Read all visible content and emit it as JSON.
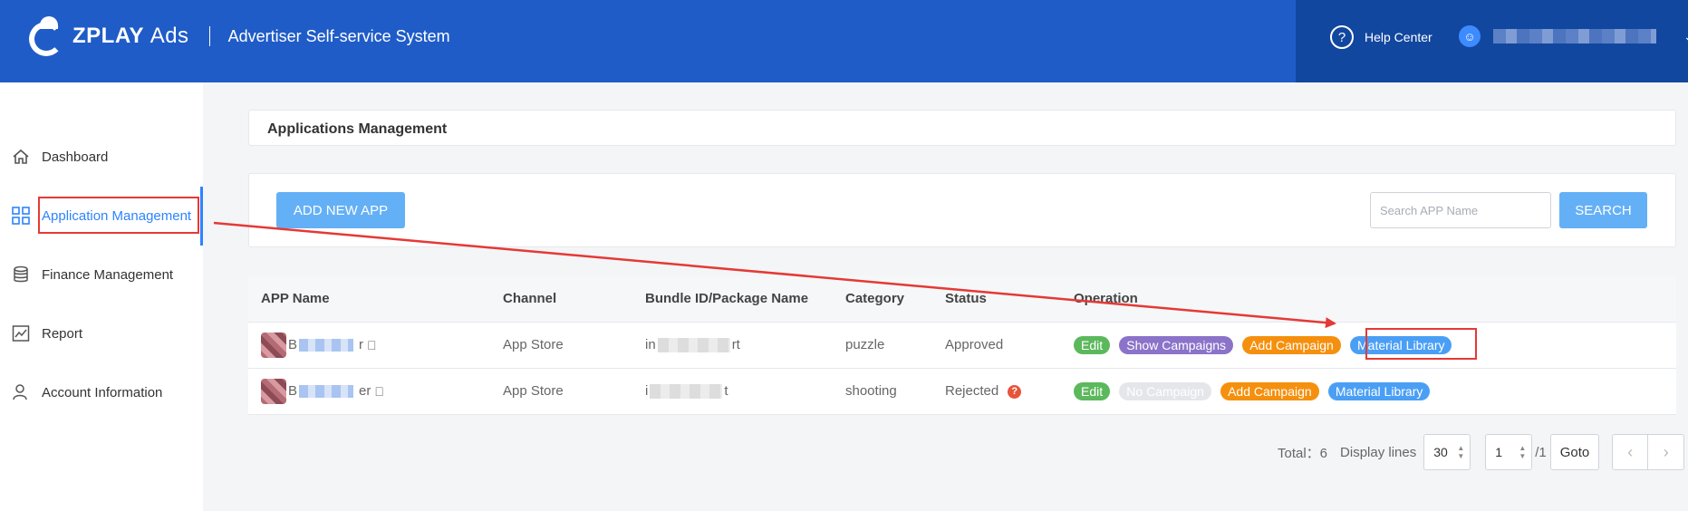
{
  "header": {
    "logo_text": "ZPLAY",
    "logo_suffix": "Ads",
    "system_title": "Advertiser Self-service System",
    "help_label": "Help Center"
  },
  "sidebar": {
    "items": [
      {
        "label": "Dashboard",
        "icon": "home-icon"
      },
      {
        "label": "Application Management",
        "icon": "grid-icon",
        "active": true
      },
      {
        "label": "Finance Management",
        "icon": "coins-icon"
      },
      {
        "label": "Report",
        "icon": "chart-icon"
      },
      {
        "label": "Account Information",
        "icon": "user-icon"
      }
    ]
  },
  "main": {
    "page_title": "Applications Management",
    "add_button": "ADD NEW APP",
    "search_placeholder": "Search APP Name",
    "search_button": "SEARCH",
    "table": {
      "headers": [
        "APP Name",
        "Channel",
        "Bundle ID/Package Name",
        "Category",
        "Status",
        "Operation"
      ],
      "rows": [
        {
          "name_start": "B",
          "name_end": "r",
          "channel": "App Store",
          "bundle_start": "in",
          "bundle_end": "rt",
          "category": "puzzle",
          "status": "Approved",
          "ops": {
            "edit": "Edit",
            "campaigns": "Show Campaigns",
            "add_campaign": "Add Campaign",
            "material": "Material Library"
          }
        },
        {
          "name_start": "B",
          "name_end": "er",
          "channel": "App Store",
          "bundle_start": "i",
          "bundle_end": "t",
          "category": "shooting",
          "status": "Rejected",
          "ops": {
            "edit": "Edit",
            "campaigns": "No Campaign",
            "add_campaign": "Add Campaign",
            "material": "Material Library"
          }
        }
      ]
    },
    "pagination": {
      "total_label": "Total：6",
      "display_lines_label": "Display lines",
      "display_lines_value": "30",
      "page_value": "1",
      "page_total": "/1",
      "goto_label": "Goto"
    }
  },
  "colors": {
    "header_bg": "#1f5cc8",
    "header_right_bg": "#12479f",
    "accent": "#2d84ff",
    "annotation_red": "#e53935"
  }
}
